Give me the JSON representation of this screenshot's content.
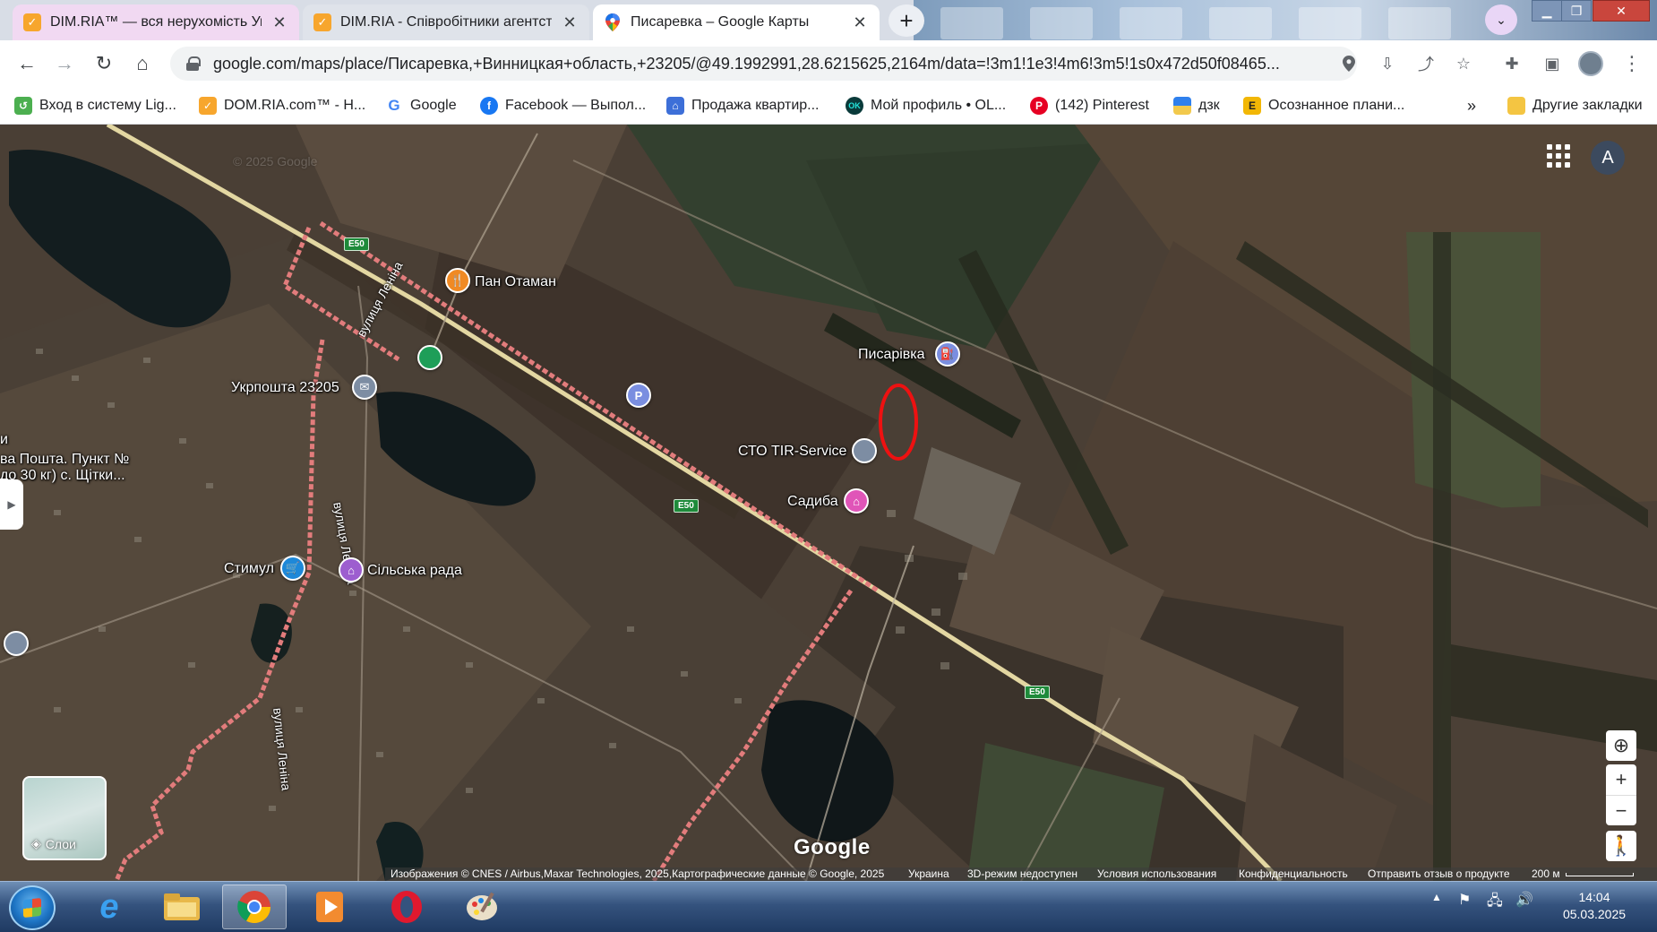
{
  "browser": {
    "tabs": [
      {
        "title": "DIM.RIA™ — вся нерухомість Ук",
        "favicon": "dimria-icon",
        "favicon_color": "#f7a62d"
      },
      {
        "title": "DIM.RIA - Співробітники агентст",
        "favicon": "dimria-icon",
        "favicon_color": "#f7a62d"
      },
      {
        "title": "Писаревка – Google Карты",
        "favicon": "google-maps-pin-icon",
        "active": true
      }
    ],
    "new_tab": "+",
    "url": "google.com/maps/place/Писаревка,+Винницкая+область,+23205/@49.1992991,28.6215625,2164m/data=!3m1!1e3!4m6!3m5!1s0x472d50f08465..."
  },
  "bookmarks": [
    {
      "label": "Вход в систему Lig...",
      "icon": "liga-icon",
      "color": "#4caf50"
    },
    {
      "label": "DOM.RIA.com™ - Н...",
      "icon": "domria-icon",
      "color": "#f7a62d"
    },
    {
      "label": "Google",
      "icon": "google-icon",
      "color": "#4285f4"
    },
    {
      "label": "Facebook — Выпол...",
      "icon": "facebook-icon",
      "color": "#1877f2"
    },
    {
      "label": "Продажа квартир...",
      "icon": "house-icon",
      "color": "#3d6fd8"
    },
    {
      "label": "Мой профиль • OL...",
      "icon": "olx-icon",
      "color": "#23e5db"
    },
    {
      "label": "(142) Pinterest",
      "icon": "pinterest-icon",
      "color": "#e60023"
    },
    {
      "label": "дзк",
      "icon": "dzk-icon",
      "color": "#f2c94c"
    },
    {
      "label": "Осознанное плани...",
      "icon": "planning-icon",
      "color": "#f2b705"
    },
    {
      "label": "»",
      "icon": "chevron-double-right-icon"
    },
    {
      "label": "Другие закладки",
      "icon": "folder-icon",
      "color": "#f4c542"
    }
  ],
  "map": {
    "labels": {
      "pan_otaman": "Пан Отаман",
      "ukrposhta": "Укрпошта 23205",
      "pysarivka": "Писарівка",
      "sto": "СТО TIR-Service",
      "sadyba": "Садиба",
      "stymul": "Стимул",
      "silska_rada": "Сільська рада",
      "nova_poshta_line1": "ва Пошта. Пункт №",
      "nova_poshta_line2": "до 30 кг) с. Щітки...",
      "partial_left": "и"
    },
    "streets": {
      "lenina_1": "вулиця Леніна",
      "lenina_2": "вулиця Леніна",
      "lenina_3": "вулиця Леніна"
    },
    "road_shield": "E50",
    "layers_label": "Слои",
    "account_initial": "A",
    "google_logo": "Google",
    "watermark": "© 2025 Google",
    "attribution": {
      "imagery": "Изображения © CNES / Airbus,Maxar Technologies, 2025,Картографические данные © Google, 2025",
      "country": "Украина",
      "mode": "3D-режим недоступен",
      "terms": "Условия использования",
      "privacy": "Конфиденциальность",
      "feedback": "Отправить отзыв о продукте",
      "scale": "200 м"
    },
    "pin_letters": {
      "parking": "P"
    }
  },
  "taskbar": {
    "time": "14:04",
    "date": "05.03.2025"
  }
}
